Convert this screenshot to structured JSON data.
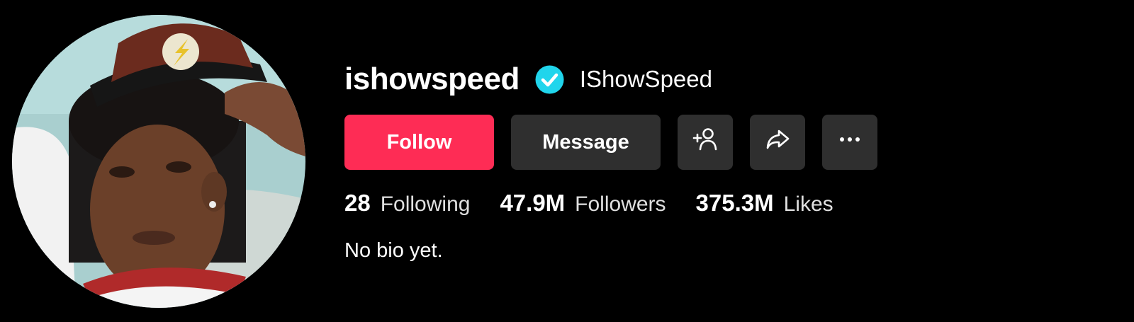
{
  "profile": {
    "username": "ishowspeed",
    "display_name": "IShowSpeed",
    "verified": true,
    "avatar_icon": "profile-photo",
    "bio": "No bio yet."
  },
  "actions": {
    "follow_label": "Follow",
    "message_label": "Message",
    "add_friend_icon": "add-friend-icon",
    "share_icon": "share-icon",
    "more_icon": "more-icon"
  },
  "stats": {
    "following_count": "28",
    "following_label": "Following",
    "followers_count": "47.9M",
    "followers_label": "Followers",
    "likes_count": "375.3M",
    "likes_label": "Likes"
  },
  "colors": {
    "background": "#000000",
    "follow_button": "#fe2c55",
    "secondary_button": "#2f2f2f",
    "verified_badge": "#20d5ec"
  }
}
